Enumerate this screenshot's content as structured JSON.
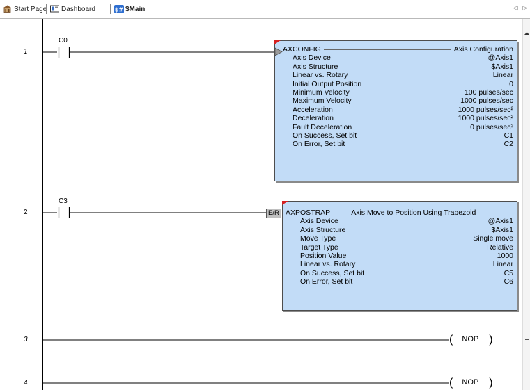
{
  "tabs": [
    {
      "label": "Start Page",
      "icon": "start-page-icon"
    },
    {
      "label": "Dashboard",
      "icon": "dashboard-icon"
    },
    {
      "label": "$Main",
      "icon": "main-program-icon",
      "active": true
    }
  ],
  "tab_arrows": "◁ ▷",
  "rungs": [
    {
      "number": "1",
      "contact": "C0"
    },
    {
      "number": "2",
      "contact": "C3"
    },
    {
      "number": "3"
    },
    {
      "number": "4"
    }
  ],
  "axconfig": {
    "name": "AXCONFIG",
    "title": "Axis Configuration",
    "rows": [
      {
        "label": "Axis Device",
        "value": "@Axis1"
      },
      {
        "label": "Axis Structure",
        "value": "$Axis1"
      },
      {
        "label": "Linear vs. Rotary",
        "value": "Linear"
      },
      {
        "label": "Initial Output Position",
        "value": "0"
      },
      {
        "label": "Minimum Velocity",
        "value": "100 pulses/sec"
      },
      {
        "label": "Maximum Velocity",
        "value": "1000 pulses/sec"
      },
      {
        "label": "Acceleration",
        "value": "1000 pulses/sec²"
      },
      {
        "label": "Deceleration",
        "value": "1000 pulses/sec²"
      },
      {
        "label": "Fault Deceleration",
        "value": "0 pulses/sec²"
      },
      {
        "label": "On Success, Set bit",
        "value": "C1"
      },
      {
        "label": "On Error, Set bit",
        "value": "C2"
      }
    ]
  },
  "axpostrap": {
    "tag": "E/R",
    "name": "AXPOSTRAP",
    "title": "Axis Move to Position Using Trapezoid",
    "rows": [
      {
        "label": "Axis Device",
        "value": "@Axis1"
      },
      {
        "label": "Axis Structure",
        "value": "$Axis1"
      },
      {
        "label": "Move Type",
        "value": "Single move"
      },
      {
        "label": "Target Type",
        "value": "Relative"
      },
      {
        "label": "Position Value",
        "value": "1000"
      },
      {
        "label": "Linear vs. Rotary",
        "value": "Linear"
      },
      {
        "label": "On Success, Set bit",
        "value": "C5"
      },
      {
        "label": "On Error, Set bit",
        "value": "C6"
      }
    ]
  },
  "nop_label": "NOP",
  "colors": {
    "box_fill": "#c2dcf7",
    "box_border": "#4d4d4d",
    "marker": "#d62020"
  }
}
